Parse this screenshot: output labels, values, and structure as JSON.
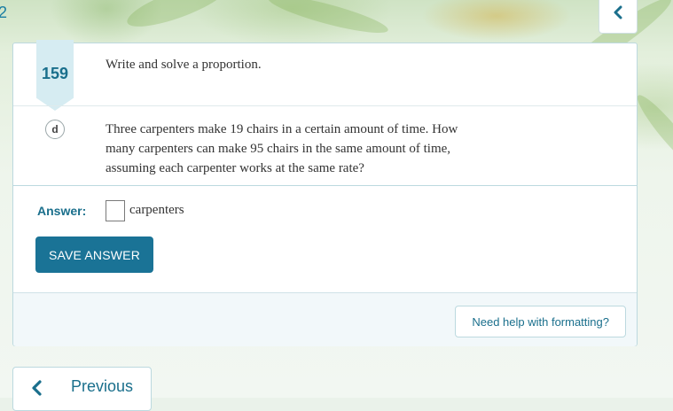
{
  "page_number_fragment": "2",
  "problem": {
    "number": "159",
    "prompt": "Write and solve a proportion.",
    "part_label": "d",
    "question": "Three carpenters make 19 chairs in a certain amount of time. How many carpenters can make 95 chairs in the same amount of time, assuming each carpenter works at the same rate?"
  },
  "answer": {
    "label": "Answer:",
    "value": "",
    "unit": "carpenters"
  },
  "buttons": {
    "save": "SAVE ANSWER",
    "help": "Need help with formatting?",
    "previous": "Previous"
  },
  "icons": {
    "collapse": "chevron-left-icon",
    "previous": "chevron-left-icon"
  },
  "colors": {
    "accent": "#1a7396",
    "accent_text": "#1a6f8c",
    "ribbon": "#d6ecf2"
  }
}
